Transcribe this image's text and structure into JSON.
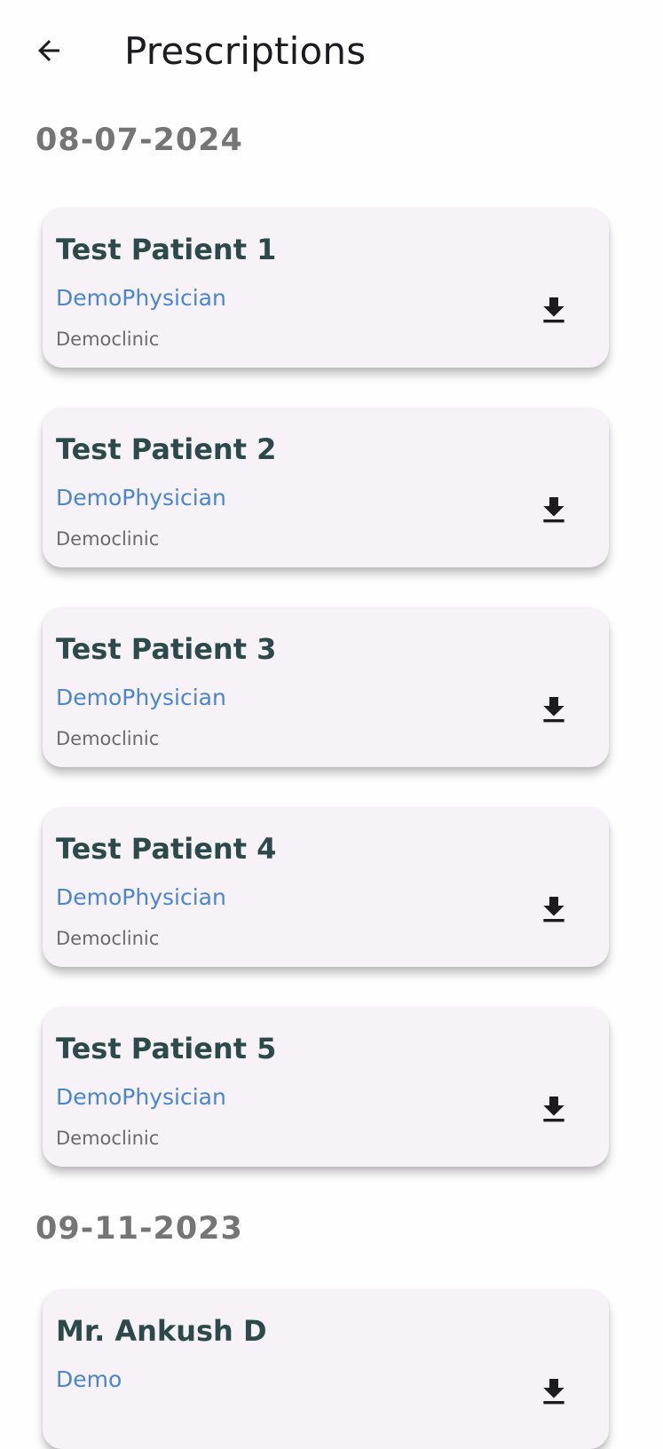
{
  "header": {
    "title": "Prescriptions"
  },
  "groups": [
    {
      "date": "08-07-2024",
      "items": [
        {
          "patient": "Test Patient 1",
          "physician": "DemoPhysician",
          "clinic": "Democlinic"
        },
        {
          "patient": "Test Patient 2",
          "physician": "DemoPhysician",
          "clinic": "Democlinic"
        },
        {
          "patient": "Test Patient 3",
          "physician": "DemoPhysician",
          "clinic": "Democlinic"
        },
        {
          "patient": "Test Patient 4",
          "physician": "DemoPhysician",
          "clinic": "Democlinic"
        },
        {
          "patient": "Test Patient 5",
          "physician": "DemoPhysician",
          "clinic": "Democlinic"
        }
      ]
    },
    {
      "date": "09-11-2023",
      "items": [
        {
          "patient": "Mr. Ankush D",
          "physician": "Demo",
          "clinic": ""
        }
      ]
    }
  ],
  "colors": {
    "title": "#1c1b1f",
    "date": "#757575",
    "patient": "#2c4a4c",
    "physician": "#4a86d0",
    "clinic": "#6d6a6e",
    "card_bg": "#f6f2f8"
  },
  "icons": {
    "back": "arrow-back-icon",
    "download": "download-icon"
  }
}
